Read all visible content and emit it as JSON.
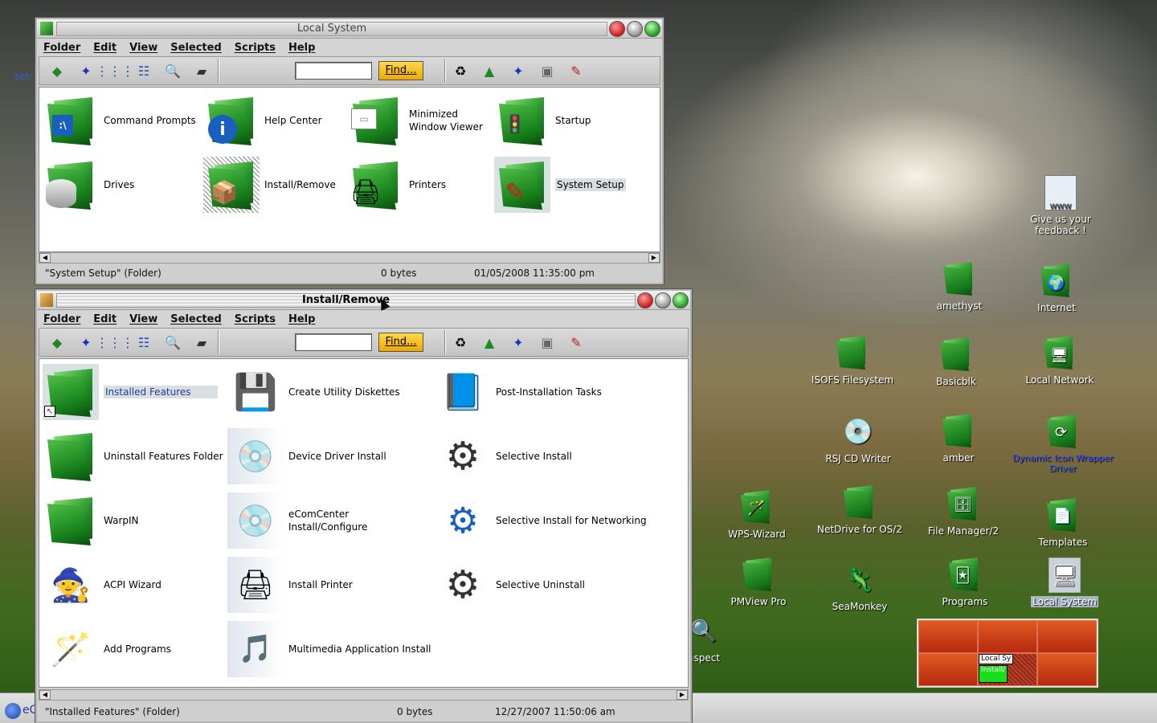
{
  "desktop": {
    "stray_text": "set-",
    "inspect_label": "nspect",
    "icons": [
      {
        "id": "feedback",
        "label": "Give us your feedback !",
        "glyph": "🌐"
      },
      {
        "id": "amethyst",
        "label": "amethyst"
      },
      {
        "id": "internet",
        "label": "Internet",
        "glyph": "🌍"
      },
      {
        "id": "isofs",
        "label": "ISOFS Filesystem"
      },
      {
        "id": "basicblk",
        "label": "Basicblk"
      },
      {
        "id": "localnet",
        "label": "Local Network",
        "glyph": "🖥"
      },
      {
        "id": "rsj",
        "label": "RSJ CD Writer",
        "glyph": "💿"
      },
      {
        "id": "amber",
        "label": "amber"
      },
      {
        "id": "dynamic",
        "label": "Dynamic Icon Wrapper Driver",
        "glyph": "⟳"
      },
      {
        "id": "wpswizard",
        "label": "WPS-Wizard",
        "glyph": "🪄"
      },
      {
        "id": "netdrive",
        "label": "NetDrive for OS/2"
      },
      {
        "id": "filemgr",
        "label": "File Manager/2",
        "glyph": "🗄"
      },
      {
        "id": "templates",
        "label": "Templates",
        "glyph": "📄"
      },
      {
        "id": "pmview",
        "label": "PMView Pro"
      },
      {
        "id": "seamonkey",
        "label": "SeaMonkey",
        "glyph": "🦎"
      },
      {
        "id": "programs",
        "label": "Programs",
        "glyph": "🃏"
      },
      {
        "id": "localsys",
        "label": "Local System",
        "glyph": "🖥"
      }
    ]
  },
  "taskbar": {
    "text": "eC"
  },
  "pager": {
    "mini1": "Local Sy",
    "mini2": "Install/"
  },
  "menu": {
    "folder": "Folder",
    "edit": "Edit",
    "view": "View",
    "selected": "Selected",
    "scripts": "Scripts",
    "help": "Help"
  },
  "find_label": "Find...",
  "win1": {
    "title": "Local System",
    "items": [
      {
        "label": "Command Prompts",
        "glyph": ":\\"
      },
      {
        "label": "Help Center",
        "glyph": "i"
      },
      {
        "label": "Minimized Window Viewer",
        "glyph": "▭"
      },
      {
        "label": "Startup",
        "glyph": "🚦"
      },
      {
        "label": "Drives",
        "glyph": "🗃"
      },
      {
        "label": "Install/Remove",
        "glyph": "📦"
      },
      {
        "label": "Printers",
        "glyph": "🖨"
      },
      {
        "label": "System Setup",
        "glyph": "✎"
      }
    ],
    "status": {
      "name": "\"System Setup\" (Folder)",
      "size": "0 bytes",
      "date": "01/05/2008 11:35:00 pm"
    }
  },
  "win2": {
    "title": "Install/Remove",
    "items": [
      {
        "label": "Installed Features",
        "glyph": "↖"
      },
      {
        "label": "Create Utility Diskettes",
        "glyph": "💾"
      },
      {
        "label": "Post-Installation Tasks",
        "glyph": "📘"
      },
      {
        "label": "Uninstall Features Folder",
        "glyph": ""
      },
      {
        "label": "Device Driver Install",
        "glyph": "💿"
      },
      {
        "label": "Selective Install",
        "glyph": "⚙"
      },
      {
        "label": "WarpIN",
        "glyph": ""
      },
      {
        "label": "eComCenter Install/Configure",
        "glyph": "💿"
      },
      {
        "label": "Selective Install for Networking",
        "glyph": "⚙"
      },
      {
        "label": "ACPI Wizard",
        "glyph": "🧙"
      },
      {
        "label": "Install Printer",
        "glyph": "🖨"
      },
      {
        "label": "Selective Uninstall",
        "glyph": "⚙"
      },
      {
        "label": "Add Programs",
        "glyph": "🪄"
      },
      {
        "label": "Multimedia Application Install",
        "glyph": "🎵"
      }
    ],
    "status": {
      "name": "\"Installed Features\" (Folder)",
      "size": "0 bytes",
      "date": "12/27/2007 11:50:06 am"
    }
  },
  "toolbar_icons": [
    "arrow-icon",
    "wand-icon",
    "icon-view-icon",
    "details-view-icon",
    "search-icon",
    "drive-icon",
    "refresh-icon",
    "folder-up-icon",
    "wps-icon",
    "disk-icon",
    "setup-icon"
  ]
}
